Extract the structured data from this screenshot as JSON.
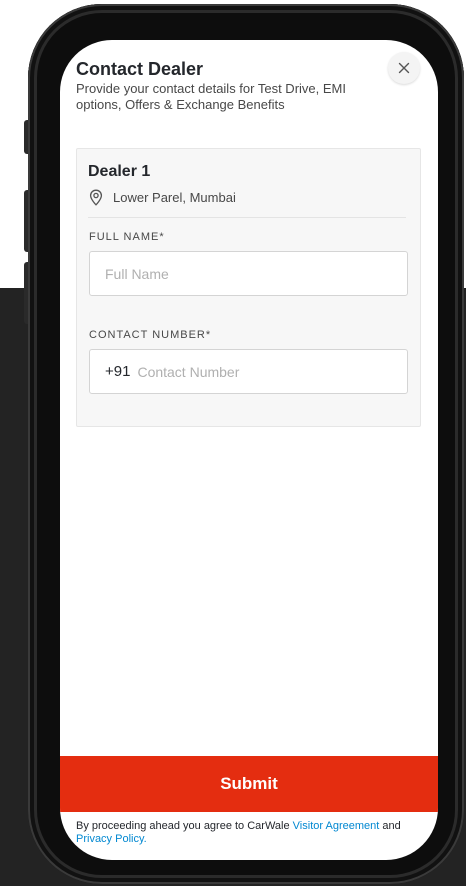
{
  "header": {
    "title": "Contact Dealer",
    "subtitle": "Provide your contact details for Test Drive, EMI options, Offers & Exchange Benefits"
  },
  "close_icon": "close-icon",
  "dealer": {
    "name": "Dealer 1",
    "location_icon": "location-pin-icon",
    "location": "Lower Parel, Mumbai"
  },
  "form": {
    "full_name_label": "FULL NAME*",
    "full_name_placeholder": "Full Name",
    "full_name_value": "",
    "contact_label": "CONTACT NUMBER*",
    "contact_prefix": "+91",
    "contact_placeholder": "Contact Number",
    "contact_value": ""
  },
  "submit_label": "Submit",
  "footer": {
    "text_before": "By proceeding ahead you agree to CarWale ",
    "visitor_agreement_link": "Visitor Agreement",
    "text_middle": " and ",
    "privacy_policy_link": "Privacy Policy",
    "text_end": "."
  },
  "colors": {
    "brand_red": "#e42d10",
    "link_blue": "#0288d1",
    "text_dark": "#24272c"
  }
}
